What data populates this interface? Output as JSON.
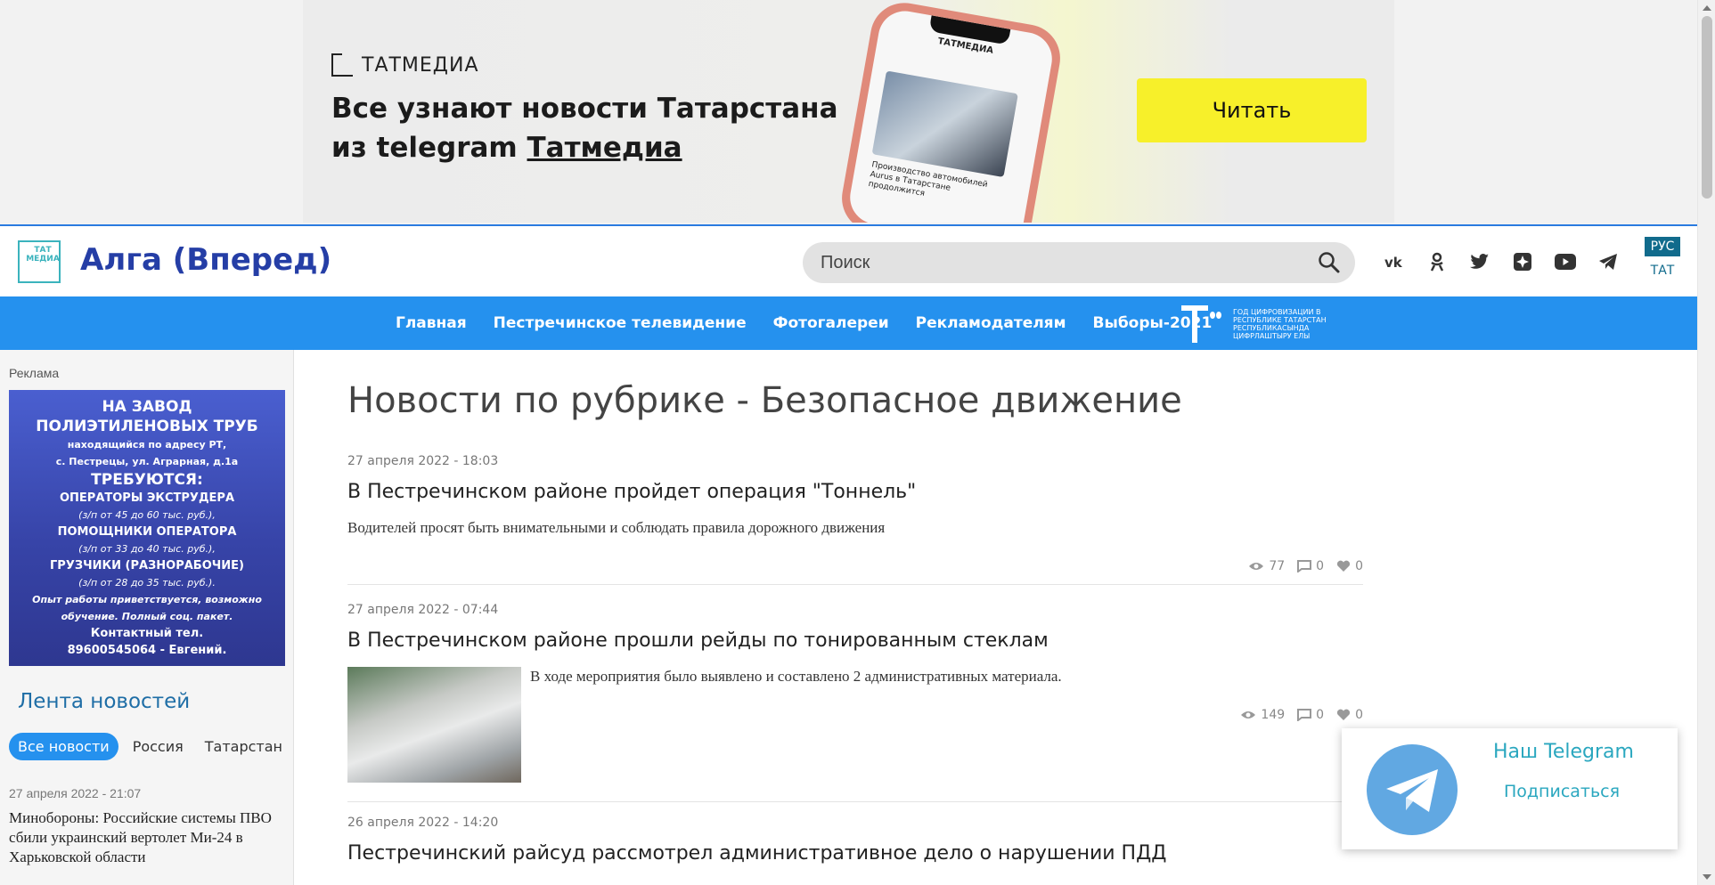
{
  "banner": {
    "brand": "ТАТМЕДИА",
    "headline_line1": "Все узнают новости Татарстана",
    "headline_line2_prefix": "из telegram ",
    "headline_line2_link": "Татмедиа",
    "phone_title": "ТАТМЕДИА",
    "phone_caption": "Производство автомобилей Aurus в Татарстане продолжится",
    "cta_label": "Читать"
  },
  "header": {
    "logo_text": "ТАТ МЕДИА",
    "site_title": "Алга (Вперед)",
    "search_placeholder": "Поиск",
    "social_icons": [
      "vk-icon",
      "odnoklassniki-icon",
      "twitter-icon",
      "yandex-zen-icon",
      "youtube-icon",
      "telegram-icon"
    ],
    "lang_active": "РУС",
    "lang_other": "ТАТ"
  },
  "nav": {
    "items": [
      "Главная",
      "Пестречинское телевидение",
      "Фотогалереи",
      "Рекламодателям",
      "Выборы-2021"
    ],
    "year_logo_text": "ГОД ЦИФРОВИЗАЦИИ В РЕСПУБЛИКЕ ТАТАРСТАН РЕСПУБЛИКАСЫНДА ЦИФРЛАШТЫРУ ЕЛЫ"
  },
  "sidebar": {
    "ad_label": "Реклама",
    "ad": {
      "line1": "НА ЗАВОД",
      "line2": "ПОЛИЭТИЛЕНОВЫХ ТРУБ",
      "line3": "находящийся по адресу РТ,",
      "line4": "с. Пестрецы, ул. Аграрная, д.1а",
      "line5": "ТРЕБУЮТСЯ:",
      "line6": "ОПЕРАТОРЫ ЭКСТРУДЕРА",
      "line7": "(з/п от 45 до 60 тыс. руб.),",
      "line8": "ПОМОЩНИКИ ОПЕРАТОРА",
      "line9": "(з/п от 33 до 40 тыс. руб.),",
      "line10": "ГРУЗЧИКИ (РАЗНОРАБОЧИЕ)",
      "line11": "(з/п от 28 до 35 тыс. руб.).",
      "line12": "Опыт работы приветствуется, возможно",
      "line13": "обучение. Полный соц. пакет.",
      "line14": "Контактный тел.",
      "line15": "89600545064 - Евгений."
    },
    "feed_title": "Лента новостей",
    "feed_tabs": [
      "Все новости",
      "Россия",
      "Татарстан"
    ],
    "feed_item_date": "27 апреля 2022 - 21:07",
    "feed_item_text": "Минобороны: Российские системы ПВО сбили украинский вертолет Ми-24 в Харьковской области"
  },
  "main": {
    "page_title": "Новости по рубрике - Безопасное движение",
    "articles": [
      {
        "date": "27 апреля 2022 - 18:03",
        "title": "В Пестречинском районе пройдет операция \"Тоннель\"",
        "lead": "Водителей просят быть внимательными и  соблюдать правила дорожного движения",
        "views": "77",
        "comments": "0",
        "likes": "0"
      },
      {
        "date": "27 апреля 2022 - 07:44",
        "title": "В Пестречинском районе прошли рейды по тонированным стеклам",
        "lead": "В ходе мероприятия было выявлено и составлено 2 административных материала.",
        "views": "149",
        "comments": "0",
        "likes": "0"
      },
      {
        "date": "26 апреля 2022 - 14:20",
        "title": "Пестречинский райсуд рассмотрел административное дело о нарушении ПДД"
      }
    ]
  },
  "telegram_popup": {
    "title": "Наш Telegram",
    "subscribe": "Подписаться"
  }
}
